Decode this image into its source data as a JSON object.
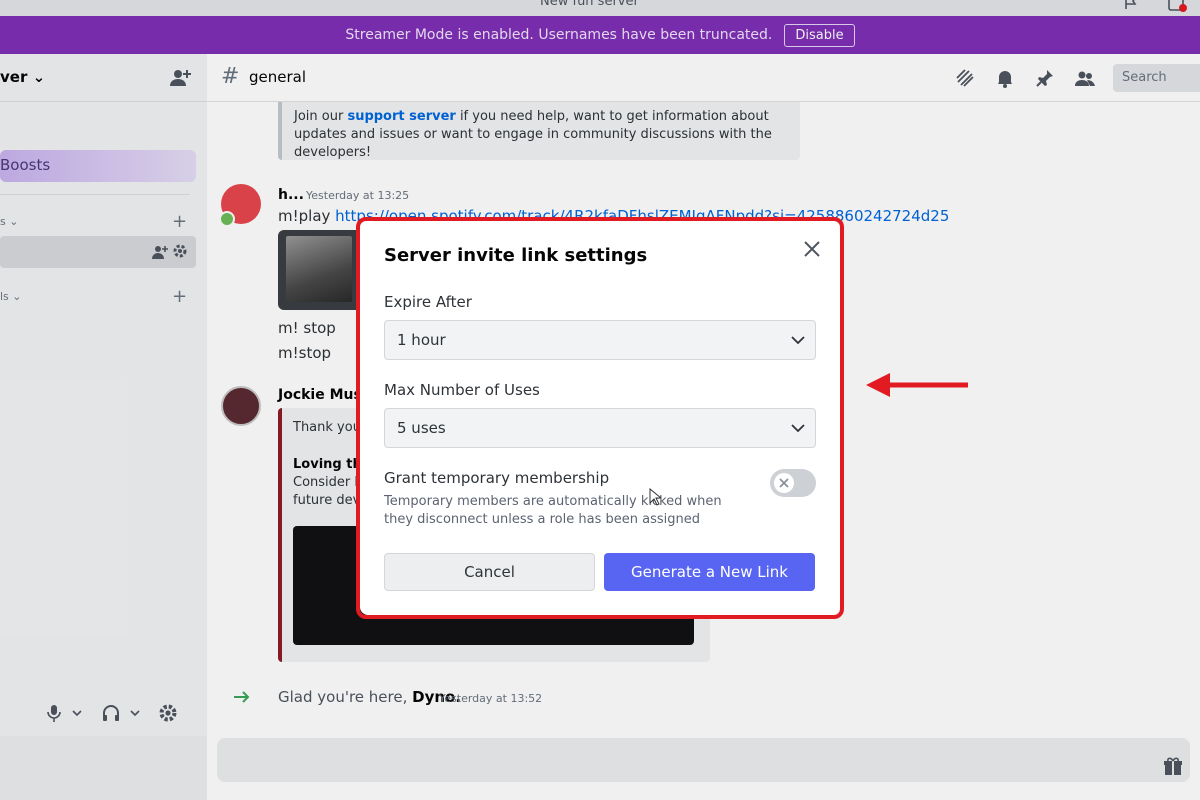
{
  "window": {
    "title": "New fun server"
  },
  "banner": {
    "message": "Streamer Mode is enabled. Usernames have been truncated.",
    "disable_label": "Disable",
    "color": "#7f2fb6"
  },
  "sidebar": {
    "server_name": "ver",
    "boosts_label": "Boosts",
    "category1_label": "s",
    "category2_label": "ls"
  },
  "channel": {
    "name": "general",
    "search_placeholder": "Search"
  },
  "messages": {
    "embed_top": {
      "text_before": "Join our ",
      "link": "support server",
      "text_after": " if you need help, want to get information about updates and issues or want to engage in community discussions with the developers!"
    },
    "msg1": {
      "user": "h...",
      "time": "Yesterday at 13:25",
      "prefix": "m!play ",
      "url": "https://open.spotify.com/track/4R2kfaDFhslZEMJqAFNpdd?si=4258860242724d25"
    },
    "stop1": "m! stop",
    "stop2": "m!stop",
    "msg2": {
      "user": "Jockie Mus",
      "embed_thanks": "Thank you",
      "embed_loving": "Loving the",
      "embed_consider": "Consider b",
      "embed_future": "future dev"
    },
    "join": {
      "text": "Glad you're here, ",
      "name": "Dyno.",
      "time": "Yesterday at 13:52"
    }
  },
  "modal": {
    "title": "Server invite link settings",
    "expire_label": "Expire After",
    "expire_value": "1 hour",
    "uses_label": "Max Number of Uses",
    "uses_value": "5 uses",
    "grant_label": "Grant temporary membership",
    "grant_desc": "Temporary members are automatically kicked when they disconnect unless a role has been assigned",
    "grant_enabled": false,
    "cancel_label": "Cancel",
    "generate_label": "Generate a New Link",
    "highlight_color": "#e21b23",
    "primary_color": "#5865f2"
  },
  "icons": [
    "flag-icon",
    "inbox-icon",
    "add-member-icon",
    "threads-icon",
    "bell-icon",
    "pin-icon",
    "members-icon",
    "mic-icon",
    "headphones-icon",
    "settings-icon",
    "gift-icon",
    "close-icon",
    "chevron-down-icon",
    "red-arrow-icon"
  ]
}
